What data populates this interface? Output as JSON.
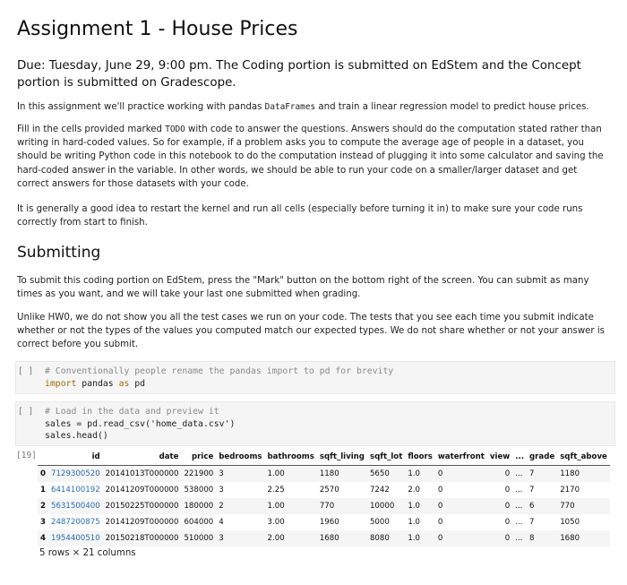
{
  "title": "Assignment 1 - House Prices",
  "due": "Due: Tuesday, June 29, 9:00 pm. The Coding portion is submitted on EdStem and the Concept portion is submitted on Gradescope.",
  "intro": {
    "before": "In this assignment we'll practice working with pandas ",
    "code": "DataFrames",
    "after": " and train a linear regression model to predict house prices."
  },
  "fill": {
    "before": "Fill in the cells provided marked ",
    "code": "TODO",
    "after": " with code to answer the questions. Answers should do the computation stated rather than writing in hard-coded values. So for example, if a problem asks you to compute the average age of people in a dataset, you should be writing Python code in this notebook to do the computation instead of plugging it into some calculator and saving the hard-coded answer in the variable. In other words, we should be able to run your code on a smaller/larger dataset and get correct answers for those datasets with your code."
  },
  "restart": "It is generally a good idea to restart the kernel and run all cells (especially before turning it in) to make sure your code runs correctly from start to finish.",
  "submitting_heading": "Submitting",
  "submit_p1": "To submit this coding portion on EdStem, press the \"Mark\" button on the bottom right of the screen. You can submit as many times as you want, and we will take your last one submitted when grading.",
  "submit_p2": "Unlike HW0, we do not show you all the test cases we run on your code. The tests that you see each time you submit indicate whether or not the types of the values you computed match our expected types. We do not share whether or not your answer is correct before you submit.",
  "cell1": {
    "prompt": "[ ]",
    "comment": "# Conventionally people rename the pandas import to pd for brevity",
    "kw1": "import",
    "mod": " pandas ",
    "kw2": "as",
    "alias": " pd"
  },
  "cell2": {
    "prompt": "[ ]",
    "comment": "# Load in the data and preview it",
    "line2": "sales = pd.read_csv('home_data.csv')",
    "line3": "sales.head()"
  },
  "output": {
    "prompt": "[19]",
    "columns": [
      "",
      "id",
      "date",
      "price",
      "bedrooms",
      "bathrooms",
      "sqft_living",
      "sqft_lot",
      "floors",
      "waterfront",
      "view",
      "...",
      "grade",
      "sqft_above"
    ],
    "rows": [
      [
        "0",
        "7129300520",
        "20141013T000000",
        "221900",
        "3",
        "1.00",
        "1180",
        "5650",
        "1.0",
        "0",
        "0",
        "...",
        "7",
        "1180"
      ],
      [
        "1",
        "6414100192",
        "20141209T000000",
        "538000",
        "3",
        "2.25",
        "2570",
        "7242",
        "2.0",
        "0",
        "0",
        "...",
        "7",
        "2170"
      ],
      [
        "2",
        "5631500400",
        "20150225T000000",
        "180000",
        "2",
        "1.00",
        "770",
        "10000",
        "1.0",
        "0",
        "0",
        "...",
        "6",
        "770"
      ],
      [
        "3",
        "2487200875",
        "20141209T000000",
        "604000",
        "4",
        "3.00",
        "1960",
        "5000",
        "1.0",
        "0",
        "0",
        "...",
        "7",
        "1050"
      ],
      [
        "4",
        "1954400510",
        "20150218T000000",
        "510000",
        "3",
        "2.00",
        "1680",
        "8080",
        "1.0",
        "0",
        "0",
        "...",
        "8",
        "1680"
      ]
    ],
    "shape": "5 rows × 21 columns"
  }
}
